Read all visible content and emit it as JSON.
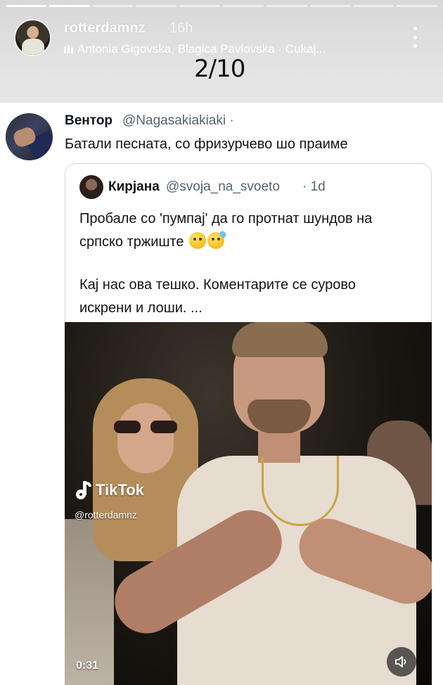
{
  "story": {
    "username": "rotterdamnz",
    "time": "16h",
    "music": "Antonia Gigovska, Blagica Pavlovska · Cukaj...",
    "progress_segments": 10,
    "progress_current": 2,
    "page_counter": "2/10"
  },
  "tweet": {
    "name": "Вентор",
    "handle": "@Nagasakiakiaki ·",
    "text": "Батали песната, со фризурчево шо праиме"
  },
  "quote": {
    "name": "Кирјана",
    "handle": "@svoja_na_svoeto",
    "time": "· 1d",
    "text_line1": "Пробале со 'пумпај' да го протнат шундов на",
    "text_line2": "српско тржиште",
    "text_line3": "Кај нас ова тешко. Коментарите се сурово",
    "text_line4": "искрени и лоши. ..."
  },
  "video": {
    "brand": "TikTok",
    "watermark_user": "@rotterdamnz",
    "duration": "0:31"
  },
  "icons": {
    "more": "more-vertical-icon",
    "music": "music-bars-icon",
    "volume": "speaker-icon",
    "tiktok": "tiktok-logo-icon"
  }
}
